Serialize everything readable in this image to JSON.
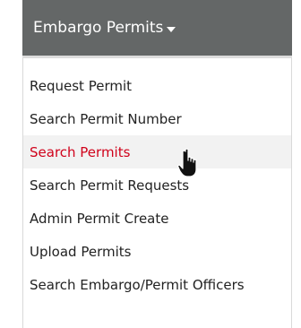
{
  "menu": {
    "title": "Embargo Permits",
    "items": [
      {
        "label": "Request Permit"
      },
      {
        "label": "Search Permit Number"
      },
      {
        "label": "Search Permits"
      },
      {
        "label": "Search Permit Requests"
      },
      {
        "label": "Admin Permit Create"
      },
      {
        "label": "Upload Permits"
      },
      {
        "label": "Search Embargo/Permit Officers"
      }
    ],
    "active_index": 2
  },
  "colors": {
    "header_bg": "#646767",
    "active_text": "#d0021b",
    "active_bg": "#f2f2f2"
  },
  "icons": {
    "caret": "caret-down-icon",
    "cursor": "hand-pointer-icon"
  }
}
